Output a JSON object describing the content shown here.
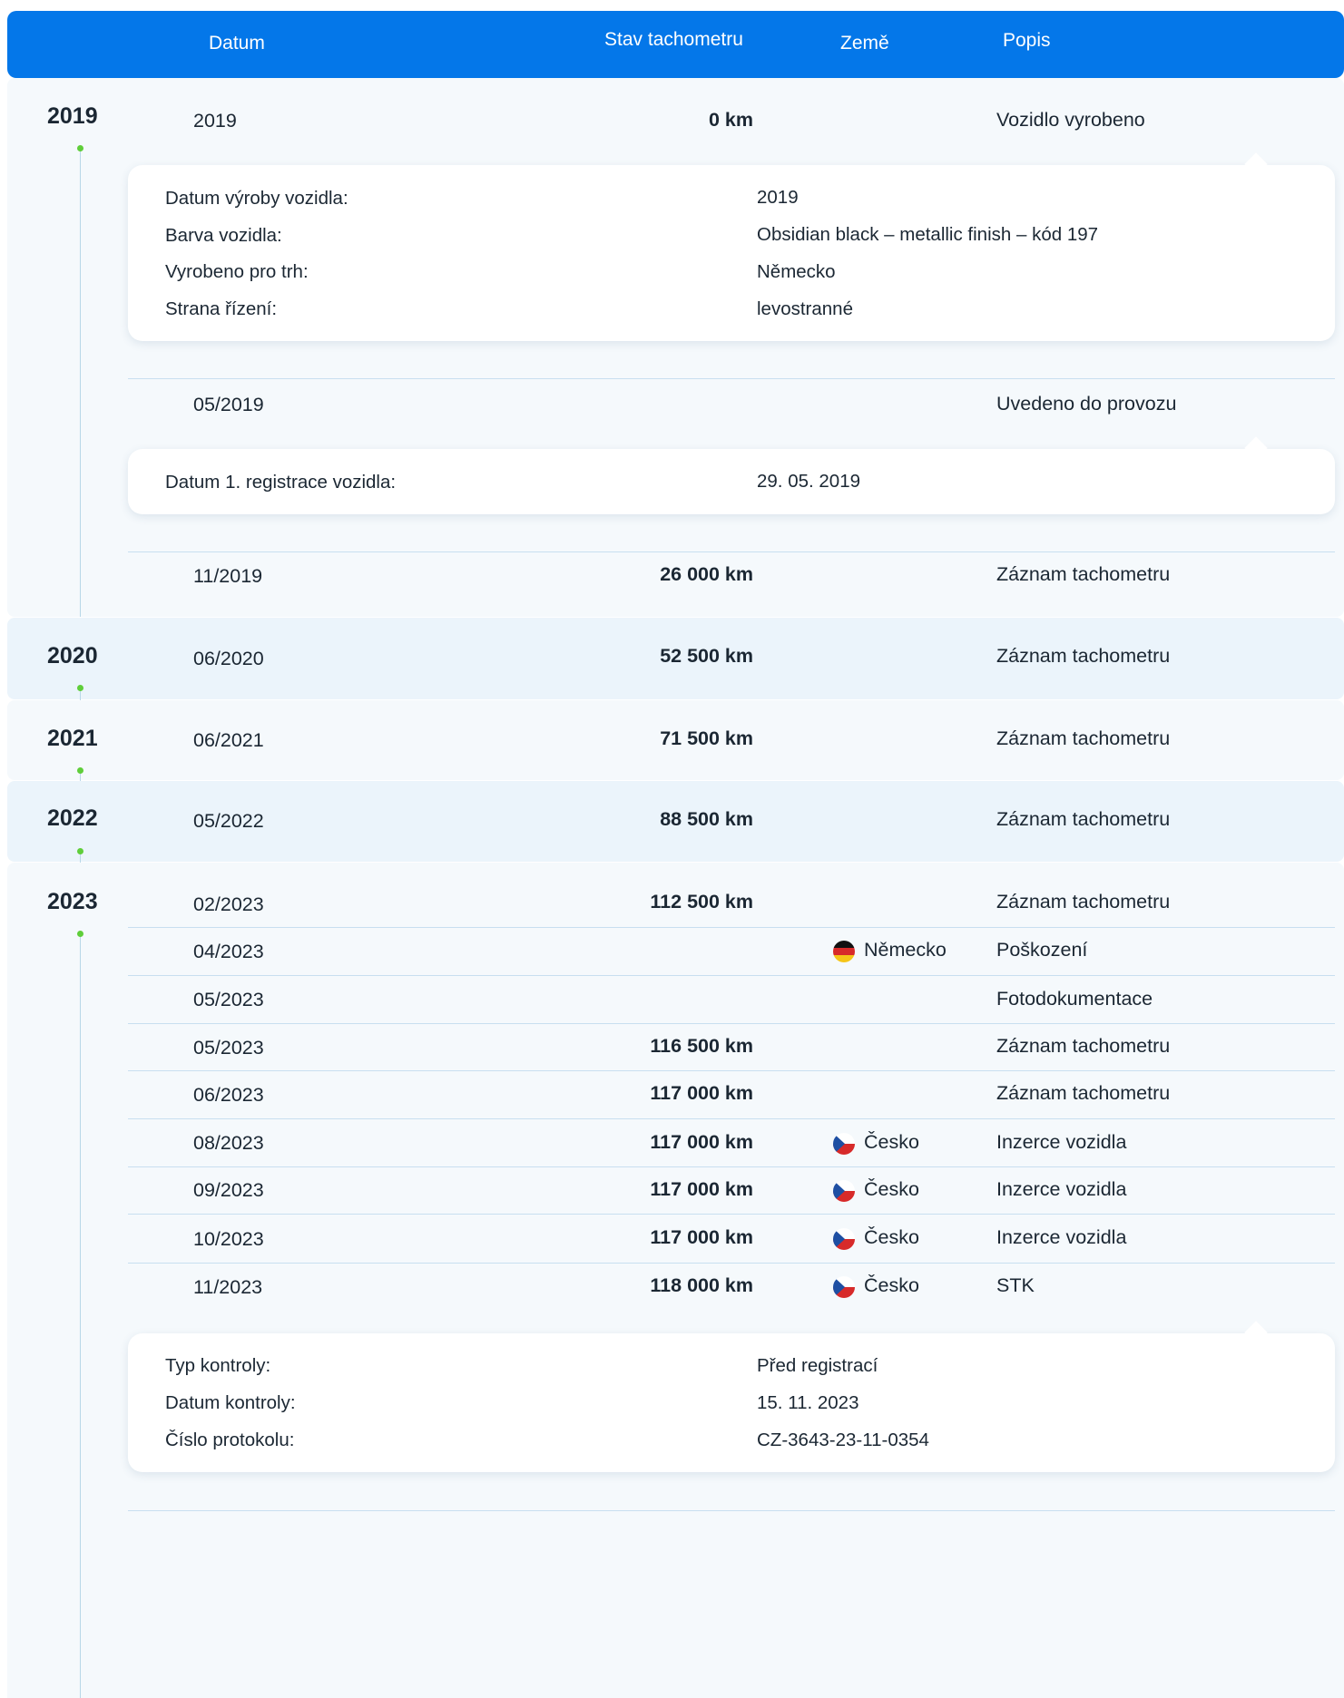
{
  "header": {
    "date": "Datum",
    "odometer": "Stav tachometru",
    "country": "Země",
    "description": "Popis"
  },
  "years": [
    {
      "year": "2019",
      "entries": [
        {
          "date": "2019",
          "km": "0 km",
          "country": "",
          "description": "Vozidlo vyrobeno"
        },
        {
          "date": "05/2019",
          "km": "",
          "country": "",
          "description": "Uvedeno do provozu"
        },
        {
          "date": "11/2019",
          "km": "26 000 km",
          "country": "",
          "description": "Záznam tachometru"
        }
      ]
    },
    {
      "year": "2020",
      "entries": [
        {
          "date": "06/2020",
          "km": "52 500 km",
          "country": "",
          "description": "Záznam tachometru"
        }
      ]
    },
    {
      "year": "2021",
      "entries": [
        {
          "date": "06/2021",
          "km": "71 500 km",
          "country": "",
          "description": "Záznam tachometru"
        }
      ]
    },
    {
      "year": "2022",
      "entries": [
        {
          "date": "05/2022",
          "km": "88 500 km",
          "country": "",
          "description": "Záznam tachometru"
        }
      ]
    },
    {
      "year": "2023",
      "entries": [
        {
          "date": "02/2023",
          "km": "112 500 km",
          "country": "",
          "description": "Záznam tachometru"
        },
        {
          "date": "04/2023",
          "km": "",
          "country": "Německo",
          "flag": "germany-flag",
          "description": "Poškození"
        },
        {
          "date": "05/2023",
          "km": "",
          "country": "",
          "description": "Fotodokumentace"
        },
        {
          "date": "05/2023",
          "km": "116 500 km",
          "country": "",
          "description": "Záznam tachometru"
        },
        {
          "date": "06/2023",
          "km": "117 000 km",
          "country": "",
          "description": "Záznam tachometru"
        },
        {
          "date": "08/2023",
          "km": "117 000 km",
          "country": "Česko",
          "flag": "czech-flag",
          "description": "Inzerce vozidla"
        },
        {
          "date": "09/2023",
          "km": "117 000 km",
          "country": "Česko",
          "flag": "czech-flag",
          "description": "Inzerce vozidla"
        },
        {
          "date": "10/2023",
          "km": "117 000 km",
          "country": "Česko",
          "flag": "czech-flag",
          "description": "Inzerce vozidla"
        },
        {
          "date": "11/2023",
          "km": "118 000 km",
          "country": "Česko",
          "flag": "czech-flag",
          "description": "STK"
        }
      ]
    }
  ],
  "cards": {
    "production": [
      {
        "label": "Datum výroby vozidla:",
        "value": "2019"
      },
      {
        "label": "Barva vozidla:",
        "value": "Obsidian black – metallic finish – kód 197"
      },
      {
        "label": "Vyrobeno pro trh:",
        "value": "Německo"
      },
      {
        "label": "Strana řízení:",
        "value": "levostranné"
      }
    ],
    "registration": [
      {
        "label": "Datum 1. registrace vozidla:",
        "value": "29. 05. 2019"
      }
    ],
    "inspection": [
      {
        "label": "Typ kontroly:",
        "value": "Před registrací"
      },
      {
        "label": "Datum kontroly:",
        "value": "15. 11. 2023"
      },
      {
        "label": "Číslo protokolu:",
        "value": "CZ-3643-23-11-0354"
      }
    ]
  },
  "colors": {
    "header": "#0477e9",
    "timeline_dot": "#5fce3a",
    "section_bg": "#f5f9fc",
    "section_alt_bg": "#ebf4fb"
  }
}
